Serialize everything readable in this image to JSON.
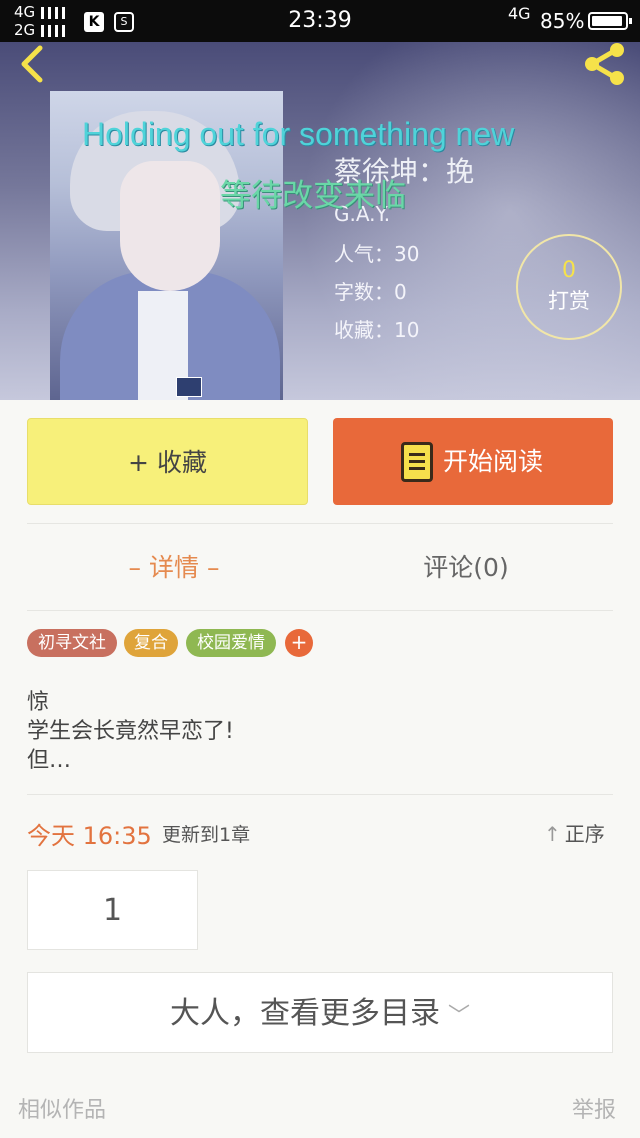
{
  "status_bar": {
    "network_top": "4G",
    "network_bottom": "2G",
    "app_icon_k": "K",
    "app_icon_2": "S",
    "time": "23:39",
    "network_right": "4G",
    "battery": "85%"
  },
  "header": {
    "lyrics_en": "Holding out for something new",
    "lyrics_zh": "等待改变来临",
    "title": "蔡徐坤：挽",
    "tag": "G.A.Y.",
    "stats": {
      "popularity": "人气：30",
      "words": "字数：0",
      "favorites": "收藏：10"
    },
    "reward": {
      "count": "0",
      "label": "打赏"
    }
  },
  "actions": {
    "favorite": "+ 收藏",
    "start_reading": "开始阅读"
  },
  "tabs": {
    "detail": "– 详情 –",
    "comments": "评论(0)"
  },
  "tags": [
    {
      "label": "初寻文社",
      "color": "#c8705f"
    },
    {
      "label": "复合",
      "color": "#dfa43a"
    },
    {
      "label": "校园爱情",
      "color": "#8fb852"
    }
  ],
  "tag_add": "+",
  "description": "惊\n学生会长竟然早恋了!\n但…",
  "update": {
    "time": "今天 16:35",
    "text": "更新到1章",
    "sort": "正序"
  },
  "chapters": [
    "1"
  ],
  "more_catalog": "大人，查看更多目录",
  "footer": {
    "similar": "相似作品",
    "report": "举报"
  }
}
